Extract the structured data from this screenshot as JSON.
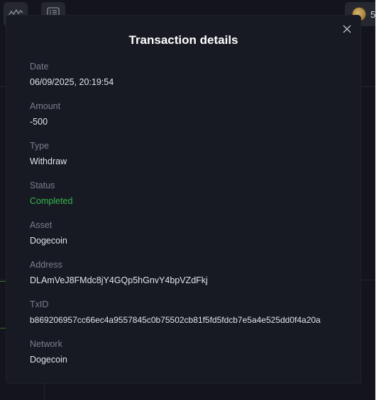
{
  "background": {
    "top_right_value": "5"
  },
  "modal": {
    "title": "Transaction details",
    "fields": [
      {
        "label": "Date",
        "value": "06/09/2025, 20:19:54"
      },
      {
        "label": "Amount",
        "value": "-500"
      },
      {
        "label": "Type",
        "value": "Withdraw"
      },
      {
        "label": "Status",
        "value": "Completed"
      },
      {
        "label": "Asset",
        "value": "Dogecoin"
      },
      {
        "label": "Address",
        "value": "DLAmVeJ8FMdc8jY4GQp5hGnvY4bpVZdFkj"
      },
      {
        "label": "TxID",
        "value": "b869206957cc66ec4a9557845c0b75502cb81f5fd5fdcb7e5a4e525dd0f4a20a"
      },
      {
        "label": "Network",
        "value": "Dogecoin"
      }
    ]
  },
  "colors": {
    "status_completed": "#35b44a",
    "modal_bg": "#181a23",
    "app_bg": "#14151c"
  },
  "icons": [
    "chart-icon",
    "list-icon",
    "dogecoin-icon",
    "close-icon"
  ]
}
